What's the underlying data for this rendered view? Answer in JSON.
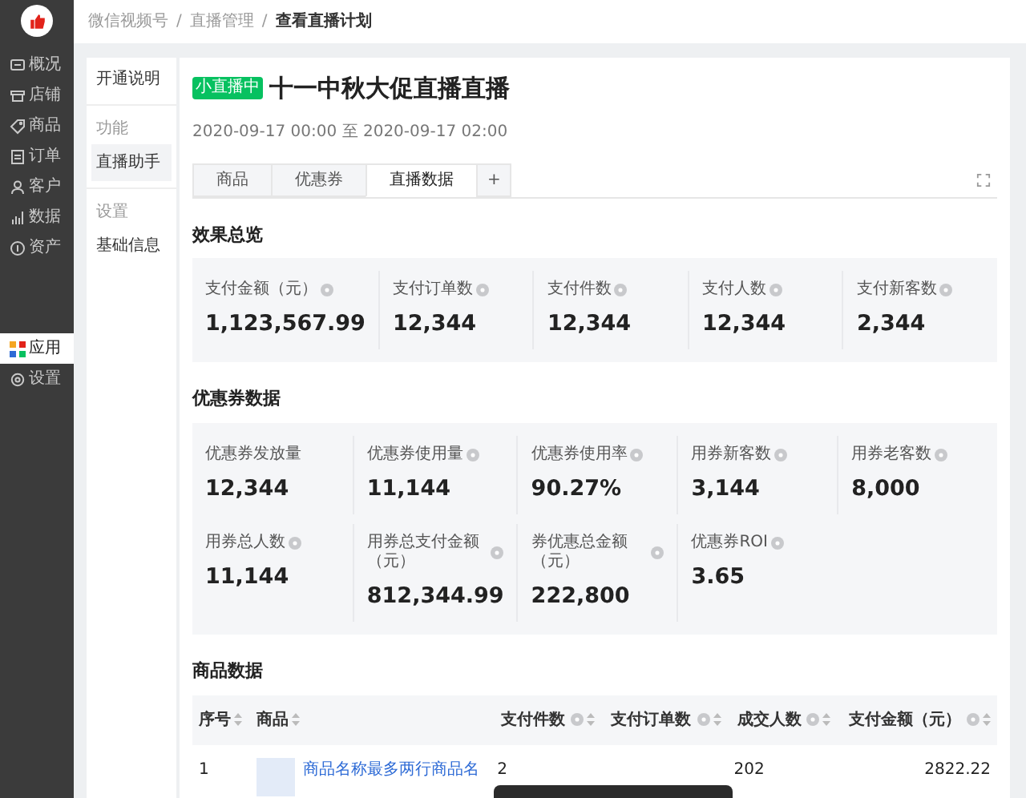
{
  "sidebar": {
    "items": [
      {
        "label": "概况",
        "selected": false
      },
      {
        "label": "店铺",
        "selected": false
      },
      {
        "label": "商品",
        "selected": false
      },
      {
        "label": "订单",
        "selected": false
      },
      {
        "label": "客户",
        "selected": false
      },
      {
        "label": "数据",
        "selected": false
      },
      {
        "label": "资产",
        "selected": false
      },
      {
        "label": "应用",
        "selected": true
      },
      {
        "label": "设置",
        "selected": false
      }
    ]
  },
  "breadcrumb": {
    "separator": "/",
    "items": [
      "微信视频号",
      "直播管理",
      "查看直播计划"
    ]
  },
  "subnav": {
    "items": [
      {
        "kind": "link",
        "label": "开通说明",
        "selected": false
      },
      {
        "kind": "group",
        "label": "功能"
      },
      {
        "kind": "link",
        "label": "直播助手",
        "selected": true
      },
      {
        "kind": "group",
        "label": "设置"
      },
      {
        "kind": "link",
        "label": "基础信息",
        "selected": false
      }
    ]
  },
  "plan": {
    "badge": "小直播中",
    "title": "十一中秋大促直播直播",
    "time_range": "2020-09-17 00:00 至 2020-09-17 02:00"
  },
  "tabs": [
    {
      "label": "商品",
      "selected": false
    },
    {
      "label": "优惠券",
      "selected": false
    },
    {
      "label": "直播数据",
      "selected": true
    },
    {
      "label": "+",
      "selected": false
    }
  ],
  "sections": [
    {
      "title": "效果总览",
      "metrics": [
        {
          "label": "支付金额（元）",
          "value": "1,123,567.99",
          "help": true
        },
        {
          "label": "支付订单数",
          "value": "12,344",
          "help": true
        },
        {
          "label": "支付件数",
          "value": "12,344",
          "help": true
        },
        {
          "label": "支付人数",
          "value": "12,344",
          "help": true
        },
        {
          "label": "支付新客数",
          "value": "2,344",
          "help": true
        }
      ]
    },
    {
      "title": "优惠券数据",
      "metrics": [
        {
          "label": "优惠券发放量",
          "value": "12,344",
          "help": false
        },
        {
          "label": "优惠券使用量",
          "value": "11,144",
          "help": true
        },
        {
          "label": "优惠券使用率",
          "value": "90.27%",
          "help": true
        },
        {
          "label": "用券新客数",
          "value": "3,144",
          "help": true
        },
        {
          "label": "用券老客数",
          "value": "8,000",
          "help": true
        },
        {
          "label": "用券总人数",
          "value": "11,144",
          "help": true
        },
        {
          "label": "用券总支付金额（元）",
          "value": "812,344.99",
          "help": true
        },
        {
          "label": "券优惠总金额（元）",
          "value": "222,800",
          "help": true
        },
        {
          "label": "优惠券ROI",
          "value": "3.65",
          "help": true
        }
      ]
    }
  ],
  "product_table": {
    "title": "商品数据",
    "columns": [
      {
        "label": "序号",
        "help": false
      },
      {
        "label": "商品",
        "help": false
      },
      {
        "label": "支付件数",
        "help": true
      },
      {
        "label": "支付订单数",
        "help": true
      },
      {
        "label": "成交人数",
        "help": true
      },
      {
        "label": "支付金额（元）",
        "help": true
      }
    ],
    "rows": [
      {
        "index": "1",
        "name": "商品名称最多两行商品名",
        "pay_items": "2",
        "buyers": "202",
        "amount": "2822.22"
      }
    ]
  },
  "toast": {
    "visible": true
  }
}
